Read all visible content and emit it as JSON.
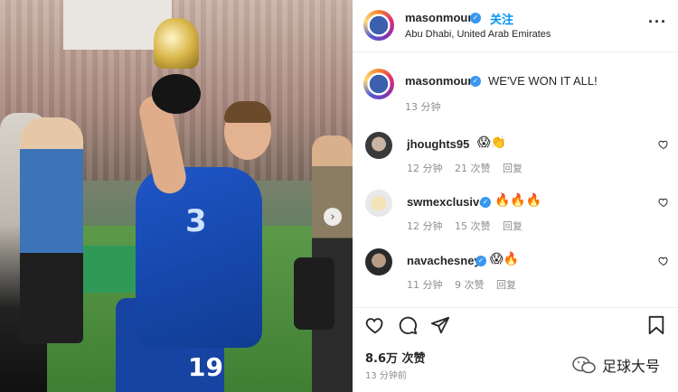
{
  "post": {
    "author": "masonmount",
    "follow_label": "关注",
    "location": "Abu Dhabi, United Arab Emirates",
    "more_label": "···",
    "caption_text": "WE'VE WON IT ALL!",
    "caption_time": "13 分钟",
    "photo": {
      "shirt_sponsor": "3",
      "shirt_number": "19",
      "carousel_next_label": "›"
    }
  },
  "comments": [
    {
      "username": "jhoughts95",
      "verified": false,
      "emoji": "😱👏",
      "time": "12 分钟",
      "likes": "21 次赞",
      "reply": "回复"
    },
    {
      "username": "swmexclusive",
      "verified": true,
      "emoji": "🔥🔥🔥",
      "time": "12 分钟",
      "likes": "15 次赞",
      "reply": "回复"
    },
    {
      "username": "navachesney",
      "verified": true,
      "emoji": "😱🔥",
      "time": "11 分钟",
      "likes": "9 次赞",
      "reply": "回复"
    }
  ],
  "footer": {
    "likes": "8.6万 次赞",
    "posted": "13 分钟前"
  },
  "watermark": {
    "text": "足球大号"
  },
  "icons": {
    "like": "heart-icon",
    "comment": "comment-icon",
    "share": "share-icon",
    "save": "bookmark-icon",
    "verified": "verified-badge-icon"
  },
  "colors": {
    "verified": "#3897f0",
    "follow": "#0095f6",
    "muted_text": "#8e8e8e"
  }
}
